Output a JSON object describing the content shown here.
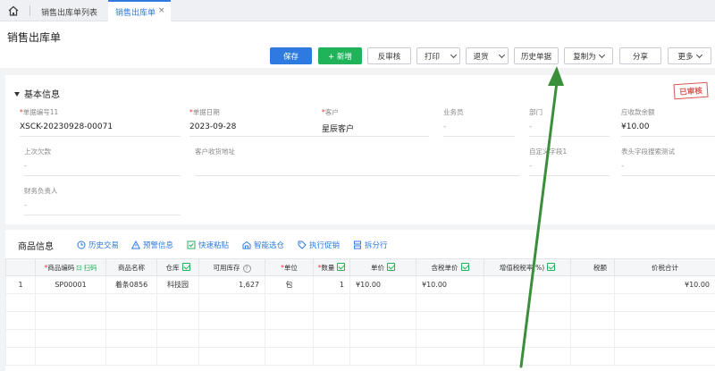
{
  "tabs": {
    "list_tab": "销售出库单列表",
    "active_tab": "销售出库单",
    "close": "×"
  },
  "page": {
    "title": "销售出库单"
  },
  "toolbar": {
    "save": "保存",
    "new": "+ 新增",
    "unaudit": "反审核",
    "print": "打印",
    "return": "退货",
    "history": "历史单据",
    "copy_as": "复制为",
    "share": "分享",
    "more": "更多"
  },
  "basic": {
    "title": "基本信息",
    "stamp": "已审核",
    "fields": {
      "doc_no": {
        "label": "单据编号11",
        "value": "XSCK-20230928-00071"
      },
      "doc_date": {
        "label": "单据日期",
        "value": "2023-09-28"
      },
      "customer": {
        "label": "客户",
        "value": "星辰客户"
      },
      "salesman": {
        "label": "业务员",
        "value": "-"
      },
      "dept": {
        "label": "部门",
        "value": "-"
      },
      "receivable": {
        "label": "应收款余额",
        "value": "¥10.00"
      },
      "last_debt": {
        "label": "上次欠款",
        "value": "-"
      },
      "ship_addr": {
        "label": "客户收货地址",
        "value": ""
      },
      "custom1": {
        "label": "自定义字段1",
        "value": "-"
      },
      "header_search": {
        "label": "表头字段搜索测试",
        "value": "-"
      },
      "finance": {
        "label": "财务负责人",
        "value": "-"
      }
    }
  },
  "goods": {
    "title": "商品信息",
    "actions": [
      "历史交易",
      "预警信息",
      "快速粘贴",
      "智能选仓",
      "执行促销",
      "拆分行"
    ],
    "scan": "扫码",
    "columns": [
      "",
      "商品编码",
      "商品名称",
      "仓库",
      "可用库存",
      "单位",
      "数量",
      "单价",
      "含税单价",
      "增值税税率(%)",
      "税额",
      "价税合计"
    ],
    "rows": [
      {
        "idx": "1",
        "code": "SP00001",
        "name": "着条0856",
        "warehouse": "科技园",
        "stock": "1,627",
        "unit": "包",
        "qty": "1",
        "price": "¥10.00",
        "tax_price": "¥10.00",
        "tax_rate": "",
        "tax": "",
        "total": "¥10.00"
      }
    ]
  },
  "colors": {
    "primary": "#2e7ae0",
    "green": "#21b35a",
    "stamp": "#d9534f",
    "arrow": "#3a8f3a"
  }
}
